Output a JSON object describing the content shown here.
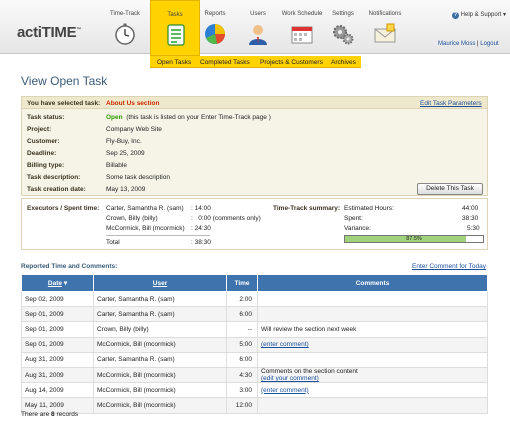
{
  "app": {
    "logo": "actiTIME",
    "tm": "™"
  },
  "nav": [
    {
      "label": "Time-Track",
      "icon": "stopwatch-icon"
    },
    {
      "label": "Tasks",
      "icon": "tasks-list-icon"
    },
    {
      "label": "Reports",
      "icon": "pie-chart-icon"
    },
    {
      "label": "Users",
      "icon": "user-icon"
    },
    {
      "label": "Work Schedule",
      "icon": "calendar-icon"
    },
    {
      "label": "Settings",
      "icon": "gears-icon"
    },
    {
      "label": "Notifications",
      "icon": "envelope-icon"
    }
  ],
  "header": {
    "help": "Help & Support",
    "user_name": "Maurice Moss",
    "logout": "Logout"
  },
  "subnav": [
    "Open Tasks",
    "Completed Tasks",
    "Projects & Customers",
    "Archives"
  ],
  "page": {
    "title": "View Open Task"
  },
  "task": {
    "selected_label": "You have selected task:",
    "selected_value": "About Us section",
    "edit_link": "Edit Task Parameters",
    "status_label": "Task status:",
    "status_value": "Open",
    "status_note": "(this task is listed on your Enter Time-Track page )",
    "project_label": "Project:",
    "project_value": "Company Web Site",
    "customer_label": "Customer:",
    "customer_value": "Fly-Buy, Inc.",
    "deadline_label": "Deadline:",
    "deadline_value": "Sep 25, 2009",
    "billing_label": "Billing type:",
    "billing_value": "Billable",
    "desc_label": "Task description:",
    "desc_value": "Some task description",
    "created_label": "Task creation date:",
    "created_value": "May 13, 2009",
    "delete_button": "Delete This Task"
  },
  "executors": {
    "label": "Executors / Spent time:",
    "rows": [
      {
        "name": "Carter, Samantha R. (sam)",
        "time": "14:00"
      },
      {
        "name": "Crown, Billy (billy)",
        "time": "0:00 (comments only)"
      },
      {
        "name": "McCormick, Bill (mcormick)",
        "time": "24:30"
      }
    ],
    "total_label": "Total",
    "total_value": "38:30"
  },
  "summary": {
    "label": "Time-Track summary:",
    "est_label": "Estimated Hours:",
    "est_value": "44:00",
    "spent_label": "Spent:",
    "spent_value": "38:30",
    "var_label": "Variance:",
    "var_value": "5:30",
    "progress": 0.875,
    "progress_text": "87.5%"
  },
  "reported": {
    "title": "Reported Time and Comments:",
    "enter_link": "Enter Comment for Today"
  },
  "table": {
    "headers": {
      "date": "Date",
      "sort": "▾",
      "user": "User",
      "time": "Time",
      "comments": "Comments"
    },
    "rows": [
      {
        "date": "Sep 02, 2009",
        "user": "Carter, Samantha R. (sam)",
        "time": "2:00",
        "comment": "",
        "link": ""
      },
      {
        "date": "Sep 01, 2009",
        "user": "Carter, Samantha R. (sam)",
        "time": "6:00",
        "comment": "",
        "link": ""
      },
      {
        "date": "Sep 01, 2009",
        "user": "Crown, Billy (billy)",
        "time": "--",
        "comment": "Will review the section next week",
        "link": ""
      },
      {
        "date": "Sep 01, 2009",
        "user": "McCormick, Bill (mcormick)",
        "time": "5:00",
        "comment": "",
        "link": "(enter comment)"
      },
      {
        "date": "Aug 31, 2009",
        "user": "Carter, Samantha R. (sam)",
        "time": "6:00",
        "comment": "",
        "link": ""
      },
      {
        "date": "Aug 31, 2009",
        "user": "McCormick, Bill (mcormick)",
        "time": "4:30",
        "comment": "Comments on the section content",
        "link": "(edit your comment)"
      },
      {
        "date": "Aug 14, 2009",
        "user": "McCormick, Bill (mcormick)",
        "time": "3:00",
        "comment": "",
        "link": "(enter comment)"
      },
      {
        "date": "May 11, 2009",
        "user": "McCormick, Bill (mcormick)",
        "time": "12:00",
        "comment": "",
        "link": ""
      }
    ]
  },
  "footer": {
    "prefix": "There are",
    "count": "8",
    "suffix": "records"
  }
}
